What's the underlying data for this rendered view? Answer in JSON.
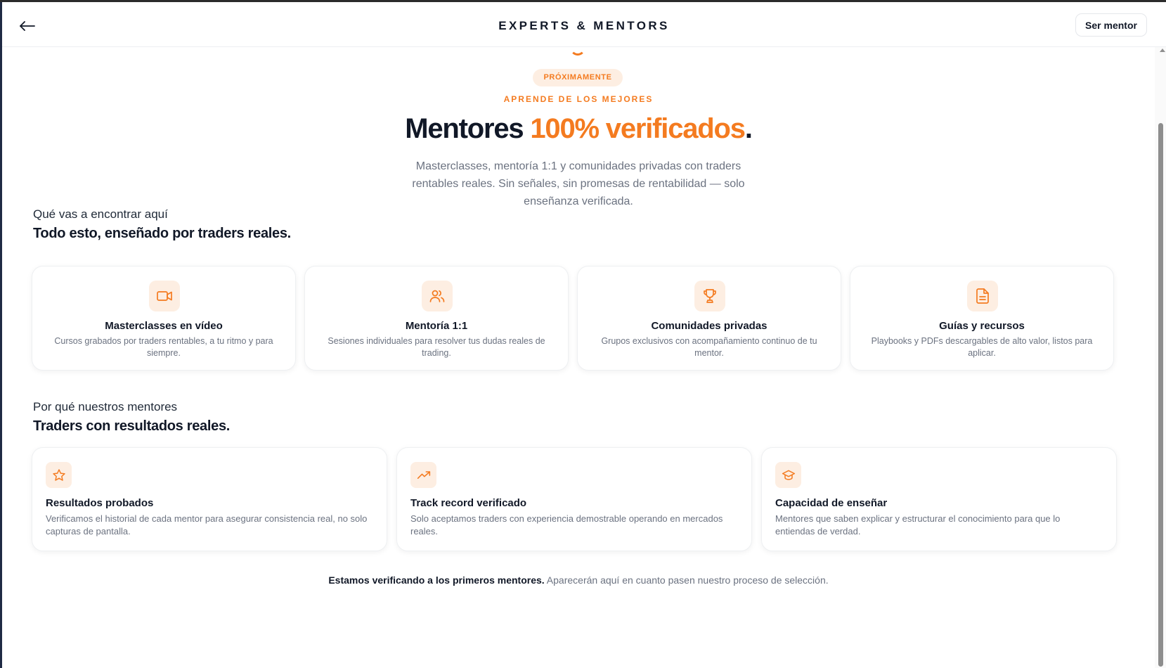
{
  "header": {
    "title": "EXPERTS & MENTORS",
    "become_mentor_label": "Ser mentor",
    "back_icon": "arrow-left-icon"
  },
  "hero": {
    "badge": "PRÓXIMAMENTE",
    "eyebrow": "APRENDE DE LOS MEJORES",
    "title_prefix": "Mentores ",
    "title_accent": "100% verificados",
    "title_suffix": ".",
    "subtitle": "Masterclasses, mentoría 1:1 y comunidades privadas con traders rentables reales. Sin señales, sin promesas de rentabilidad — solo enseñanza verificada."
  },
  "features_section": {
    "kicker": "Qué vas a encontrar aquí",
    "title": "Todo esto, enseñado por traders reales.",
    "items": [
      {
        "icon": "video-camera-icon",
        "title": "Masterclasses en vídeo",
        "desc": "Cursos grabados por traders rentables, a tu ritmo y para siempre."
      },
      {
        "icon": "users-icon",
        "title": "Mentoría 1:1",
        "desc": "Sesiones individuales para resolver tus dudas reales de trading."
      },
      {
        "icon": "trophy-icon",
        "title": "Comunidades privadas",
        "desc": "Grupos exclusivos con acompañamiento continuo de tu mentor."
      },
      {
        "icon": "document-icon",
        "title": "Guías y recursos",
        "desc": "Playbooks y PDFs descargables de alto valor, listos para aplicar."
      }
    ]
  },
  "why_section": {
    "kicker": "Por qué nuestros mentores",
    "title": "Traders con resultados reales.",
    "items": [
      {
        "icon": "star-icon",
        "title": "Resultados probados",
        "desc": "Verificamos el historial de cada mentor para asegurar consistencia real, no solo capturas de pantalla."
      },
      {
        "icon": "trending-up-icon",
        "title": "Track record verificado",
        "desc": "Solo aceptamos traders con experiencia demostrable operando en mercados reales."
      },
      {
        "icon": "graduation-cap-icon",
        "title": "Capacidad de enseñar",
        "desc": "Mentores que saben explicar y estructurar el conocimiento para que lo entiendas de verdad."
      }
    ]
  },
  "footer": {
    "strong": "Estamos verificando a los primeros mentores.",
    "rest": " Aparecerán aquí en cuanto pasen nuestro proceso de selección."
  },
  "colors": {
    "accent": "#f47b20",
    "accent_soft": "#fdeee2",
    "text_dark": "#111827",
    "text_muted": "#6b7280"
  }
}
